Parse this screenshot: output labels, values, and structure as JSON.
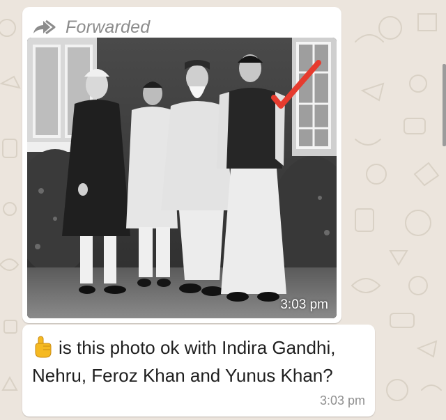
{
  "forwarded": {
    "label": "Forwarded",
    "icon": "forward-icon"
  },
  "photo_message": {
    "timestamp": "3:03 pm",
    "annotation": {
      "type": "red-checkmark",
      "color": "#e63b2e"
    }
  },
  "text_message": {
    "icon": "pointing-up-emoji",
    "line1": "is this photo ok with Indira Gandhi,",
    "line2": "Nehru, Feroz Khan and Yunus Khan?",
    "timestamp": "3:03 pm"
  },
  "colors": {
    "chat_background": "#ece5dd",
    "bubble": "#ffffff",
    "meta_text": "#8c8c8c",
    "check_mark": "#e63b2e"
  }
}
